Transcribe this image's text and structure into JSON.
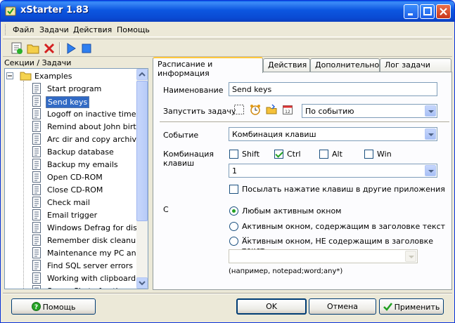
{
  "window": {
    "title": "xStarter 1.83"
  },
  "menu": [
    "Файл",
    "Задачи",
    "Действия",
    "Помощь"
  ],
  "sections_header": "Секции / Задачи",
  "tree": {
    "root": "Examples",
    "selected_index": 1,
    "items": [
      "Start program",
      "Send keys",
      "Logoff on inactive time",
      "Remind about John birt...",
      "Arc dir and copy archive",
      "Backup database",
      "Backup my emails",
      "Open CD-ROM",
      "Close CD-ROM",
      "Check mail",
      "Email trigger",
      "Windows Defrag for dis...",
      "Remember disk cleanu...",
      "Maintenance my PC an...",
      "Find SQL server errors",
      "Working with clipboard ...",
      "ScreenShot of active w..."
    ]
  },
  "tabs": [
    "Расписание и информация",
    "Действия",
    "Дополнительно",
    "Лог задачи"
  ],
  "form": {
    "name_label": "Наименование",
    "name_value": "Send keys",
    "run_label": "Запустить задачу",
    "run_value": "По событию",
    "event_label": "Событие",
    "event_value": "Комбинация клавиш",
    "combo_label": "Комбинация клавиш",
    "mods": [
      {
        "label": "Shift",
        "checked": false
      },
      {
        "label": "Ctrl",
        "checked": true
      },
      {
        "label": "Alt",
        "checked": false
      },
      {
        "label": "Win",
        "checked": false
      }
    ],
    "key_value": "1",
    "send_other_label": "Посылать нажатие клавиш в другие приложения",
    "send_other_checked": false,
    "c_label": "С",
    "radios": [
      {
        "label": "Любым активным окном",
        "checked": true
      },
      {
        "label": "Активным окном, содержащим в заголовке текст ...",
        "checked": false
      },
      {
        "label": "Активным окном, НЕ содержащим в заголовке текст ...",
        "checked": false
      }
    ],
    "window_text_value": "",
    "example_hint": "(например, notepad;word;any*)"
  },
  "buttons": {
    "help": "Помощь",
    "ok": "OK",
    "cancel": "Отмена",
    "apply": "Применить"
  },
  "colors": {
    "titlebar": "#0a4bd4",
    "selection": "#316ac5",
    "active_tab_accent": "#ffc83c"
  }
}
